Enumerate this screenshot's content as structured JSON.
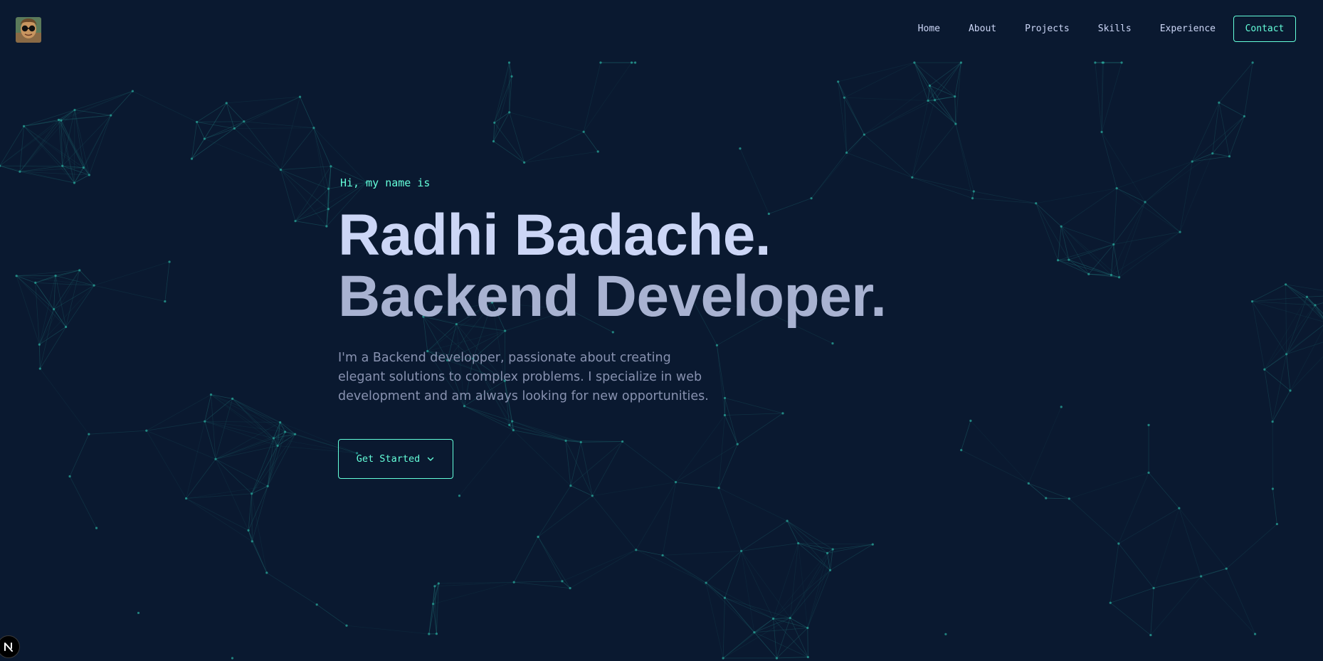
{
  "nav": {
    "links": [
      "Home",
      "About",
      "Projects",
      "Skills",
      "Experience"
    ],
    "contact_label": "Contact"
  },
  "hero": {
    "greeting": "Hi, my name is",
    "name": "Radhi Badache.",
    "role": "Backend Developer.",
    "bio": "I'm a Backend developper, passionate about creating elegant solutions to complex problems. I specialize in web development and am always looking for new opportunities.",
    "cta_label": "Get Started"
  },
  "icons": {
    "logo": "avatar-with-sunglasses-icon",
    "cta_icon": "chevron-down-icon",
    "badge": "nextjs-n-icon"
  },
  "colors": {
    "background": "#0a1930",
    "accent": "#64ffda",
    "heading": "#ccd6f6",
    "subheading": "#a8b2d1",
    "body": "#8892b0",
    "network": "#1e6a70"
  }
}
